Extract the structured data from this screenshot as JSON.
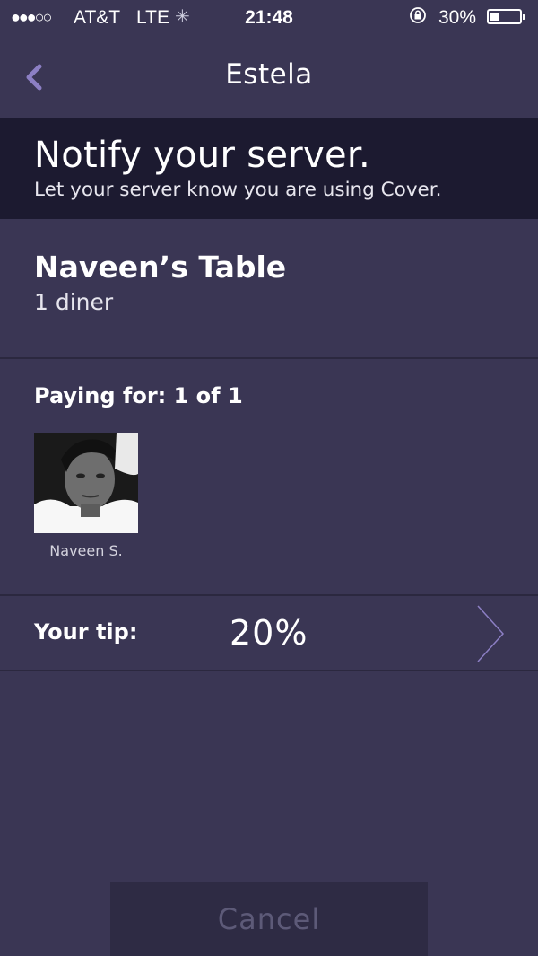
{
  "status_bar": {
    "signal": "●●●○○",
    "carrier": "AT&T",
    "network": "LTE",
    "activity_icon": "loading-spinner-icon",
    "time": "21:48",
    "rotation_lock_icon": "rotation-lock-icon",
    "battery_percent": "30%",
    "battery_level": 0.3
  },
  "nav": {
    "back_icon": "chevron-left-icon",
    "title": "Estela"
  },
  "banner": {
    "title": "Notify your server.",
    "subtitle": "Let your server know you are using Cover."
  },
  "table": {
    "name": "Naveen’s Table",
    "diners": "1 diner"
  },
  "paying": {
    "label": "Paying for: 1 of 1",
    "diners": [
      {
        "name": "Naveen S.",
        "avatar": "user-avatar-photo"
      }
    ]
  },
  "tip": {
    "label": "Your tip:",
    "value": "20%",
    "chevron_icon": "chevron-right-icon"
  },
  "actions": {
    "cancel_label": "Cancel"
  },
  "colors": {
    "background": "#3a3654",
    "banner": "#1c1a30",
    "accent": "#8c7fc4",
    "cancel_bg": "#2e2b44",
    "cancel_text": "#5d5a78"
  }
}
